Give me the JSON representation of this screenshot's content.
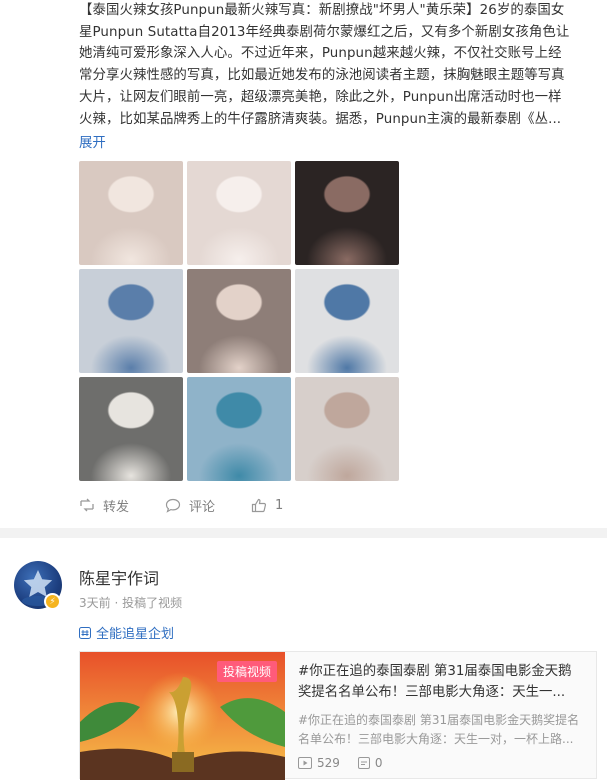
{
  "post1": {
    "text_lines": [
      "【泰国火辣女孩Punpun最新火辣写真：新剧撩战\"坏男人\"黄乐荣】26岁的泰国女",
      "星Punpun Sutatta自2013年经典泰剧荷尔蒙爆红之后，又有多个新剧女孩角色让",
      "她清纯可爱形象深入人心。不过近年来，Punpun越来越火辣，不仅社交账号上经",
      "常分享火辣性感的写真，比如最近她发布的泳池阅读者主题，抹胸魅眼主题等写真",
      "大片，让网友们眼前一亮，超级漂亮美艳，除此之外，Punpun出席活动时也一样",
      "火辣，比如某品牌秀上的牛仔露脐清爽装。据悉，Punpun主演的最新泰剧《丛..."
    ],
    "expand_label": "展开",
    "photos": [
      {
        "name": "photo-1",
        "bg": "#d9c9c1",
        "accent": "#f1e6df"
      },
      {
        "name": "photo-2",
        "bg": "#e4d8d3",
        "accent": "#f6efec"
      },
      {
        "name": "photo-3",
        "bg": "#2b2423",
        "accent": "#8a6b63"
      },
      {
        "name": "photo-4",
        "bg": "#c8cfd8",
        "accent": "#5a7eaa"
      },
      {
        "name": "photo-5",
        "bg": "#8e7e78",
        "accent": "#e3d2c9"
      },
      {
        "name": "photo-6",
        "bg": "#dfe0e2",
        "accent": "#4f78a6"
      },
      {
        "name": "photo-7",
        "bg": "#6e6e6c",
        "accent": "#e7e4df"
      },
      {
        "name": "photo-8",
        "bg": "#8fb3c9",
        "accent": "#3f8aa8"
      },
      {
        "name": "photo-9",
        "bg": "#d7cfcb",
        "accent": "#bfa79c"
      }
    ],
    "actions": {
      "repost_label": "转发",
      "comment_label": "评论",
      "like_count": "1"
    }
  },
  "post2": {
    "author": "陈星宇作词",
    "meta": "3天前 · 投稿了视频",
    "tag_label": "全能追星企划",
    "card": {
      "label": "投稿视频",
      "title_lines": [
        "#你正在追的泰国泰剧 第31届泰国电影金天鹅",
        "奖提名名单公布！三部电影大角逐：天生一..."
      ],
      "desc_lines": [
        "#你正在追的泰国泰剧 第31届泰国电影金天鹅奖提名",
        "名单公布！三部电影大角逐：天生一对，一杯上路..."
      ],
      "plays": "529",
      "comments": "0"
    }
  },
  "colors": {
    "link": "#2f6ec1",
    "muted": "#808080",
    "label_pink": "#ff5b7a"
  }
}
